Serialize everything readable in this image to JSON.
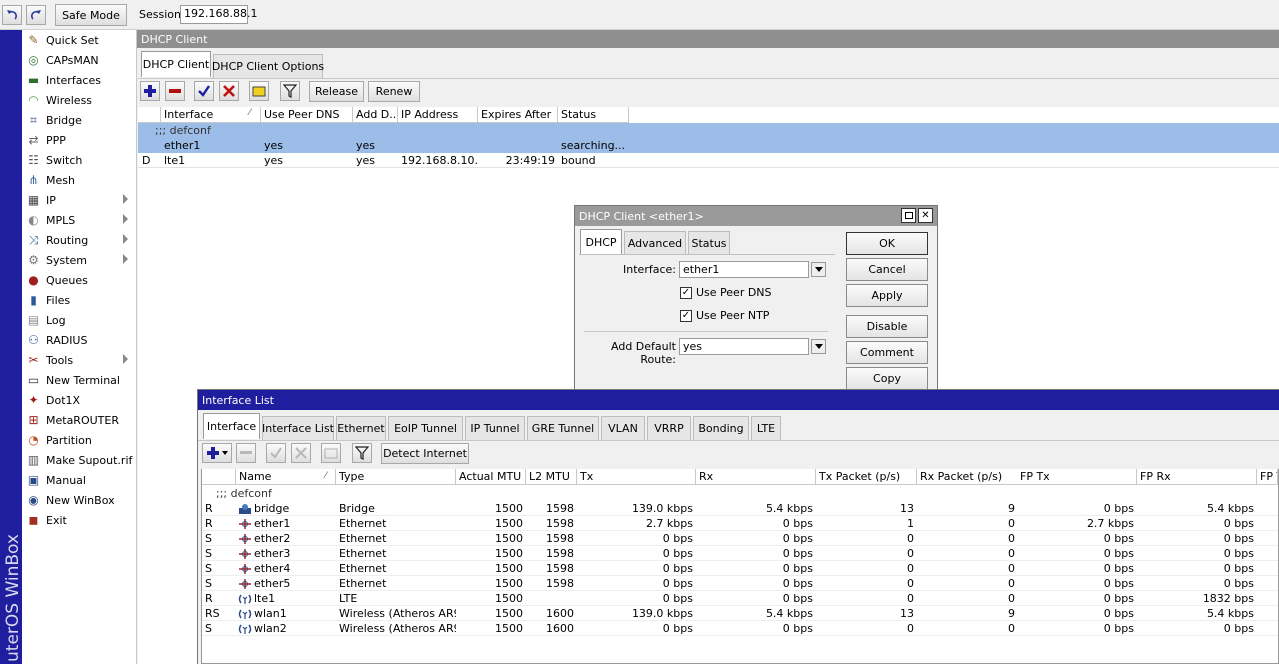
{
  "toolbar": {
    "safe_mode": "Safe Mode",
    "session_label": "Session:",
    "session_value": "192.168.88.1"
  },
  "brand_vertical": "uterOS WinBox",
  "sidebar": [
    {
      "label": "Quick Set",
      "icon": "wand-icon"
    },
    {
      "label": "CAPsMAN",
      "icon": "capsman-icon"
    },
    {
      "label": "Interfaces",
      "icon": "interfaces-icon"
    },
    {
      "label": "Wireless",
      "icon": "wireless-icon"
    },
    {
      "label": "Bridge",
      "icon": "bridge-icon"
    },
    {
      "label": "PPP",
      "icon": "ppp-icon"
    },
    {
      "label": "Switch",
      "icon": "switch-icon"
    },
    {
      "label": "Mesh",
      "icon": "mesh-icon"
    },
    {
      "label": "IP",
      "icon": "ip-icon",
      "submenu": true
    },
    {
      "label": "MPLS",
      "icon": "mpls-icon",
      "submenu": true
    },
    {
      "label": "Routing",
      "icon": "routing-icon",
      "submenu": true
    },
    {
      "label": "System",
      "icon": "gear-icon",
      "submenu": true
    },
    {
      "label": "Queues",
      "icon": "queues-icon"
    },
    {
      "label": "Files",
      "icon": "folder-icon"
    },
    {
      "label": "Log",
      "icon": "log-icon"
    },
    {
      "label": "RADIUS",
      "icon": "radius-icon"
    },
    {
      "label": "Tools",
      "icon": "tools-icon",
      "submenu": true
    },
    {
      "label": "New Terminal",
      "icon": "terminal-icon"
    },
    {
      "label": "Dot1X",
      "icon": "dot1x-icon"
    },
    {
      "label": "MetaROUTER",
      "icon": "metarouter-icon"
    },
    {
      "label": "Partition",
      "icon": "partition-icon"
    },
    {
      "label": "Make Supout.rif",
      "icon": "supout-icon"
    },
    {
      "label": "Manual",
      "icon": "manual-icon"
    },
    {
      "label": "New WinBox",
      "icon": "winbox-icon"
    },
    {
      "label": "Exit",
      "icon": "exit-icon"
    }
  ],
  "dhcp_panel": {
    "title": "DHCP Client",
    "tabs": [
      "DHCP Client",
      "DHCP Client Options"
    ],
    "buttons": {
      "release": "Release",
      "renew": "Renew"
    },
    "columns": [
      "Interface",
      "Use Peer DNS",
      "Add D...",
      "IP Address",
      "Expires After",
      "Status"
    ],
    "group": ";;; defconf",
    "rows": [
      {
        "flag": "",
        "interface": "ether1",
        "use_peer_dns": "yes",
        "add_default": "yes",
        "ip": "",
        "expires": "",
        "status": "searching..."
      },
      {
        "flag": "D",
        "interface": "lte1",
        "use_peer_dns": "yes",
        "add_default": "yes",
        "ip": "192.168.8.10...",
        "expires": "23:49:19",
        "status": "bound"
      }
    ]
  },
  "dialog": {
    "title": "DHCP Client <ether1>",
    "tabs": [
      "DHCP",
      "Advanced",
      "Status"
    ],
    "interface_label": "Interface:",
    "interface_value": "ether1",
    "use_peer_dns": "Use Peer DNS",
    "use_peer_ntp": "Use Peer NTP",
    "default_route_label": "Add Default Route:",
    "default_route_value": "yes",
    "buttons": [
      "OK",
      "Cancel",
      "Apply",
      "Disable",
      "Comment",
      "Copy"
    ]
  },
  "iface_panel": {
    "title": "Interface List",
    "tabs": [
      "Interface",
      "Interface List",
      "Ethernet",
      "EoIP Tunnel",
      "IP Tunnel",
      "GRE Tunnel",
      "VLAN",
      "VRRP",
      "Bonding",
      "LTE"
    ],
    "detect_button": "Detect Internet",
    "columns": [
      "Name",
      "Type",
      "Actual MTU",
      "L2 MTU",
      "Tx",
      "Rx",
      "Tx Packet (p/s)",
      "Rx Packet (p/s)",
      "FP Tx",
      "FP Rx",
      "FP T"
    ],
    "group": ";;; defconf",
    "rows": [
      {
        "flag": "R",
        "icon": "bridge-icon",
        "name": "bridge",
        "type": "Bridge",
        "mtu": "1500",
        "l2mtu": "1598",
        "tx": "139.0 kbps",
        "rx": "5.4 kbps",
        "txp": "13",
        "rxp": "9",
        "fptx": "0 bps",
        "fprx": "5.4 kbps"
      },
      {
        "flag": "R",
        "icon": "ethernet-icon",
        "name": "ether1",
        "type": "Ethernet",
        "mtu": "1500",
        "l2mtu": "1598",
        "tx": "2.7 kbps",
        "rx": "0 bps",
        "txp": "1",
        "rxp": "0",
        "fptx": "2.7 kbps",
        "fprx": "0 bps"
      },
      {
        "flag": "S",
        "icon": "ethernet-icon",
        "name": "ether2",
        "type": "Ethernet",
        "mtu": "1500",
        "l2mtu": "1598",
        "tx": "0 bps",
        "rx": "0 bps",
        "txp": "0",
        "rxp": "0",
        "fptx": "0 bps",
        "fprx": "0 bps"
      },
      {
        "flag": "S",
        "icon": "ethernet-icon",
        "name": "ether3",
        "type": "Ethernet",
        "mtu": "1500",
        "l2mtu": "1598",
        "tx": "0 bps",
        "rx": "0 bps",
        "txp": "0",
        "rxp": "0",
        "fptx": "0 bps",
        "fprx": "0 bps"
      },
      {
        "flag": "S",
        "icon": "ethernet-icon",
        "name": "ether4",
        "type": "Ethernet",
        "mtu": "1500",
        "l2mtu": "1598",
        "tx": "0 bps",
        "rx": "0 bps",
        "txp": "0",
        "rxp": "0",
        "fptx": "0 bps",
        "fprx": "0 bps"
      },
      {
        "flag": "S",
        "icon": "ethernet-icon",
        "name": "ether5",
        "type": "Ethernet",
        "mtu": "1500",
        "l2mtu": "1598",
        "tx": "0 bps",
        "rx": "0 bps",
        "txp": "0",
        "rxp": "0",
        "fptx": "0 bps",
        "fprx": "0 bps"
      },
      {
        "flag": "R",
        "icon": "wireless-iface-icon",
        "name": "lte1",
        "type": "LTE",
        "mtu": "1500",
        "l2mtu": "",
        "tx": "0 bps",
        "rx": "0 bps",
        "txp": "0",
        "rxp": "0",
        "fptx": "0 bps",
        "fprx": "1832 bps"
      },
      {
        "flag": "RS",
        "icon": "wireless-iface-icon",
        "name": "wlan1",
        "type": "Wireless (Atheros AR9...",
        "mtu": "1500",
        "l2mtu": "1600",
        "tx": "139.0 kbps",
        "rx": "5.4 kbps",
        "txp": "13",
        "rxp": "9",
        "fptx": "0 bps",
        "fprx": "5.4 kbps"
      },
      {
        "flag": "S",
        "icon": "wireless-iface-icon",
        "name": "wlan2",
        "type": "Wireless (Atheros AR9...",
        "mtu": "1500",
        "l2mtu": "1600",
        "tx": "0 bps",
        "rx": "0 bps",
        "txp": "0",
        "rxp": "0",
        "fptx": "0 bps",
        "fprx": "0 bps"
      }
    ]
  },
  "colors": {
    "accent": "#1e1e9e",
    "selected_row": "#9bbde8",
    "title_bar": "#8f8f8f"
  }
}
